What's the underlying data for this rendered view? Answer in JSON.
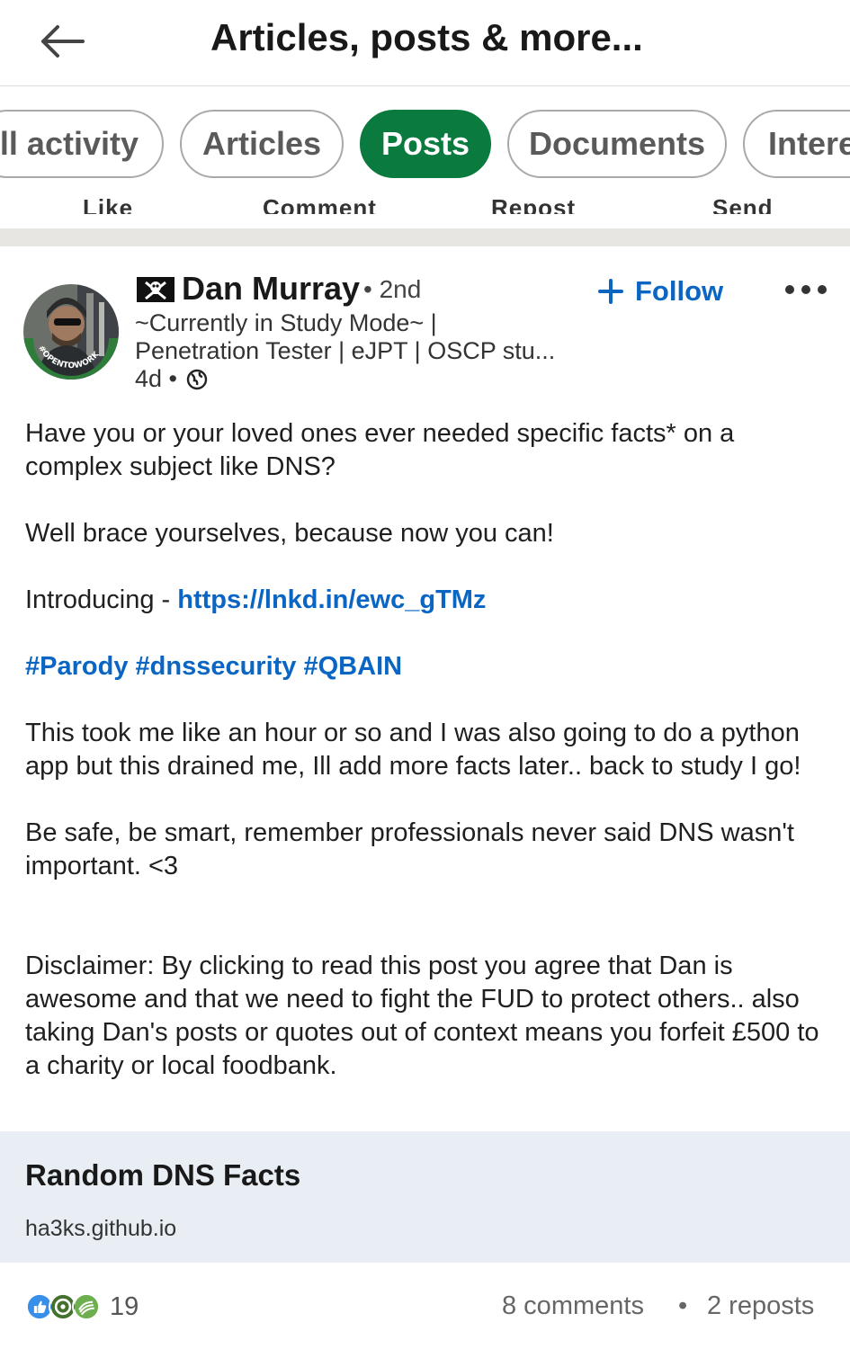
{
  "header": {
    "title": "Articles, posts & more..."
  },
  "filters": {
    "chips": [
      {
        "label": "All activity",
        "visible_text": "ll activity"
      },
      {
        "label": "Articles"
      },
      {
        "label": "Posts",
        "active": true
      },
      {
        "label": "Documents"
      },
      {
        "label": "Interests",
        "visible_text": "Intere"
      }
    ]
  },
  "action_bar_ghost": {
    "like": "Like",
    "comment": "Comment",
    "repost": "Repost",
    "send": "Send"
  },
  "post": {
    "author": {
      "name": "Dan Murray",
      "degree": "• 2nd",
      "headline_line1": "~Currently in Study Mode~ |",
      "headline_line2": "Penetration Tester | eJPT | OSCP stu...",
      "time": "4d •",
      "avatar_badge": "#OPENTOWORK"
    },
    "follow_label": "Follow",
    "body": {
      "p1": "Have you or your loved ones ever needed specific facts* on a complex subject like DNS?",
      "p2": "Well brace yourselves, because now you can!",
      "p3_prefix": "Introducing - ",
      "p3_link": "https://lnkd.in/ewc_gTMz",
      "hashtags": [
        "#Parody",
        "#dnssecurity",
        "#QBAIN"
      ],
      "p5": "This took me like an hour or so and I was also going to do a python app but this drained me, Ill add more facts later.. back to study I go!",
      "p6": "Be safe, be smart, remember professionals never said DNS wasn't important. <3",
      "p7": "Disclaimer: By clicking to read this post you agree that Dan is awesome and that we need to fight the FUD to protect others.. also taking Dan's posts or quotes out of context means you forfeit £500 to a charity or local foodbank."
    },
    "link_card": {
      "title": "Random DNS Facts",
      "domain": "ha3ks.github.io"
    },
    "social": {
      "reaction_count": "19",
      "comments": "8 comments",
      "separator": "•",
      "reposts": "2 reposts"
    }
  },
  "colors": {
    "accent_green": "#0a7a3f",
    "link_blue": "#0a66c2",
    "card_bg": "#e9eef5"
  },
  "icons": [
    "back-arrow-icon",
    "pirate-flag-icon",
    "globe-icon",
    "plus-icon",
    "more-icon",
    "like-reaction-icon",
    "celebrate-reaction-icon",
    "support-reaction-icon"
  ]
}
